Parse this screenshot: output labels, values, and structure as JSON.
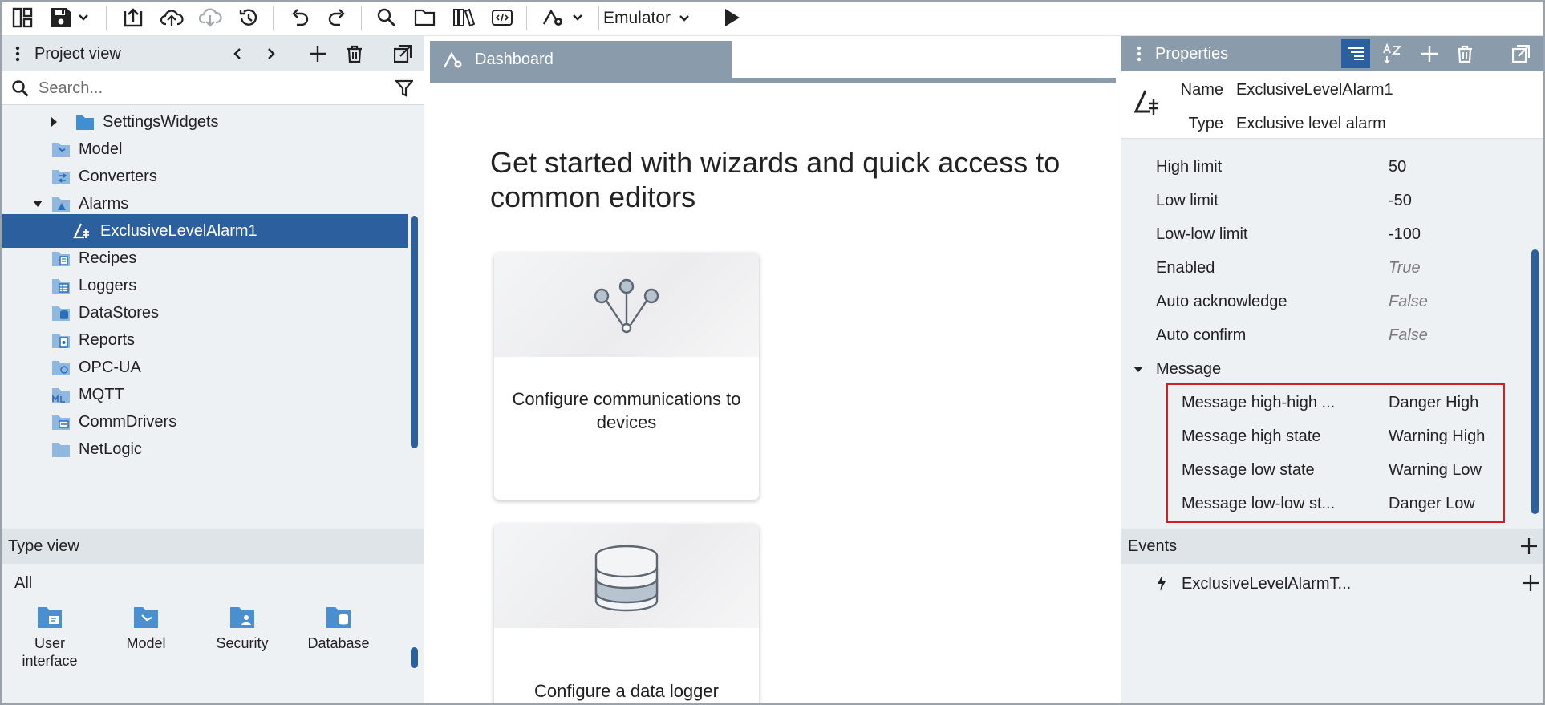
{
  "toolbar": {
    "emulator_label": "Emulator",
    "icons": [
      "layout-icon",
      "save-icon",
      "dropdown-chevron-icon",
      "upload-icon",
      "cloud-upload-icon",
      "cloud-download-icon",
      "history-icon",
      "undo-icon",
      "redo-icon",
      "search-icon",
      "open-folder-icon",
      "library-icon",
      "code-icon",
      "deploy-settings-icon",
      "run-icon"
    ]
  },
  "project_view": {
    "title": "Project view",
    "search_placeholder": "Search...",
    "items": [
      {
        "label": "SettingsWidgets",
        "expander": "collapsed"
      },
      {
        "label": "Model"
      },
      {
        "label": "Converters"
      },
      {
        "label": "Alarms",
        "expander": "expanded"
      },
      {
        "label": "ExclusiveLevelAlarm1",
        "selected": true
      },
      {
        "label": "Recipes"
      },
      {
        "label": "Loggers"
      },
      {
        "label": "DataStores"
      },
      {
        "label": "Reports"
      },
      {
        "label": "OPC-UA"
      },
      {
        "label": "MQTT"
      },
      {
        "label": "CommDrivers"
      },
      {
        "label": "NetLogic"
      }
    ]
  },
  "type_view": {
    "title": "Type view",
    "filter": "All",
    "tiles": [
      {
        "label": "User interface"
      },
      {
        "label": "Model"
      },
      {
        "label": "Security"
      },
      {
        "label": "Database"
      }
    ]
  },
  "center": {
    "tab_label": "Dashboard",
    "headline": "Get started with wizards and quick access to common editors",
    "cards": [
      {
        "label": "Configure communications to devices"
      },
      {
        "label": "Configure a data logger"
      }
    ]
  },
  "properties": {
    "title": "Properties",
    "name_label": "Name",
    "name_value": "ExclusiveLevelAlarm1",
    "type_label": "Type",
    "type_value": "Exclusive level alarm",
    "rows": [
      {
        "label": "High limit",
        "value": "50"
      },
      {
        "label": "Low limit",
        "value": "-50"
      },
      {
        "label": "Low-low limit",
        "value": "-100"
      },
      {
        "label": "Enabled",
        "value": "True"
      },
      {
        "label": "Auto acknowledge",
        "value": "False"
      },
      {
        "label": "Auto confirm",
        "value": "False"
      }
    ],
    "message_group": "Message",
    "message_rows": [
      {
        "label": "Message high-high ...",
        "value": "Danger High"
      },
      {
        "label": "Message high state",
        "value": "Warning High"
      },
      {
        "label": "Message low state",
        "value": "Warning Low"
      },
      {
        "label": "Message low-low st...",
        "value": "Danger Low"
      }
    ]
  },
  "events": {
    "title": "Events",
    "items": [
      {
        "label": "ExclusiveLevelAlarmT..."
      }
    ]
  },
  "colors": {
    "accent": "#2c5f9e",
    "header_gray": "#8a9bab",
    "highlight_red": "#d01f26"
  }
}
